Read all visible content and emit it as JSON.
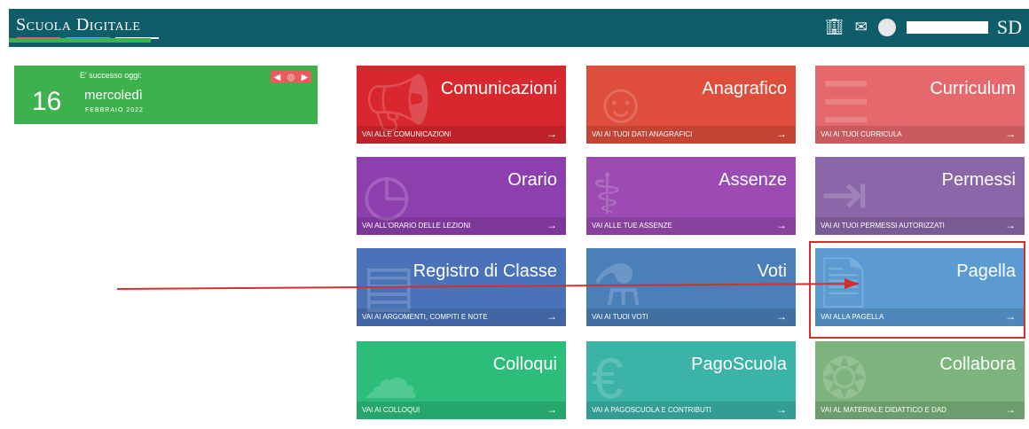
{
  "header": {
    "logo_text": "Scuola Digitale",
    "logo_line_colors": [
      "#e85c8c",
      "#4aa3df",
      "#ffffff"
    ],
    "icons": [
      "building-icon",
      "mail-open-icon"
    ],
    "user_initials": "SD"
  },
  "date_widget": {
    "caption": "E' successo oggi:",
    "day_number": "16",
    "weekday": "mercoledì",
    "month_year": "FEBBRAIO 2022",
    "controls": [
      "arrow-left-icon",
      "target-icon",
      "arrow-right-icon"
    ]
  },
  "tiles": [
    {
      "title": "Comunicazioni",
      "footer": "VAI ALLE COMUNICAZIONI",
      "color": "#d9272e",
      "icon": "megaphone-icon"
    },
    {
      "title": "Anagrafico",
      "footer": "VAI AI TUOI DATI ANAGRAFICI",
      "color": "#df4d3d",
      "icon": "person-icon"
    },
    {
      "title": "Curriculum",
      "footer": "VAI AI TUOI CURRICULA",
      "color": "#e5686c",
      "icon": "list-icon"
    },
    {
      "title": "Orario",
      "footer": "VAI ALL'ORARIO DELLE LEZIONI",
      "color": "#8e3fae",
      "icon": "clock-icon"
    },
    {
      "title": "Assenze",
      "footer": "VAI ALLE TUE ASSENZE",
      "color": "#9b4bb2",
      "icon": "stethoscope-icon"
    },
    {
      "title": "Permessi",
      "footer": "VAI AI TUOI PERMESSI AUTORIZZATI",
      "color": "#8a67a8",
      "icon": "exit-icon"
    },
    {
      "title": "Registro di Classe",
      "footer": "VAI AI ARGOMENTI, COMPITI E NOTE",
      "color": "#4a72b9",
      "icon": "register-icon"
    },
    {
      "title": "Voti",
      "footer": "VAI AI TUOI VOTI",
      "color": "#4a7fb8",
      "icon": "flask-icon"
    },
    {
      "title": "Pagella",
      "footer": "VAI ALLA PAGELLA",
      "color": "#5b9bd2",
      "icon": "document-icon"
    },
    {
      "title": "Colloqui",
      "footer": "VAI AI COLLOQUI",
      "color": "#2dbd7a",
      "icon": "chat-icon"
    },
    {
      "title": "PagoScuola",
      "footer": "VAI A PAGOSCUOLA E CONTRIBUTI",
      "color": "#3bb3a6",
      "icon": "euro-icon"
    },
    {
      "title": "Collabora",
      "footer": "VAI AL MATERIALE DIDATTICO E DAD",
      "color": "#7db37c",
      "icon": "puzzle-icon"
    }
  ],
  "annotation": {
    "highlighted_tile": "Pagella",
    "color": "#d32f2f"
  }
}
